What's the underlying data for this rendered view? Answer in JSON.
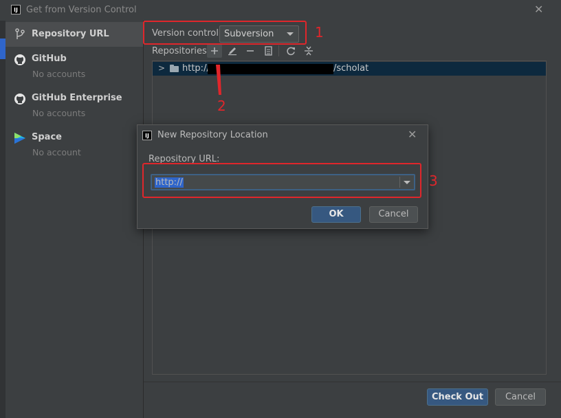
{
  "window": {
    "title": "Get from Version Control",
    "logo_text": "IJ"
  },
  "sidebar": {
    "items": [
      {
        "title": "Repository URL",
        "subtitle": "",
        "icon": "branch-icon",
        "selected": true
      },
      {
        "title": "GitHub",
        "subtitle": "No accounts",
        "icon": "github-icon",
        "selected": false
      },
      {
        "title": "GitHub Enterprise",
        "subtitle": "No accounts",
        "icon": "github-icon",
        "selected": false
      },
      {
        "title": "Space",
        "subtitle": "No account",
        "icon": "space-icon",
        "selected": false
      }
    ]
  },
  "main": {
    "version_control_label": "Version control:",
    "version_control_value": "Subversion",
    "repositories_label": "Repositories:",
    "toolbar": [
      "add-icon",
      "edit-icon",
      "remove-icon",
      "copy-icon",
      "refresh-icon",
      "collapse-icon"
    ],
    "repo_row": {
      "prefix": "http://",
      "suffix": "/scholat"
    }
  },
  "annotations": {
    "n1": "1",
    "n2": "2",
    "n3": "3"
  },
  "dialog": {
    "title": "New Repository Location",
    "url_label": "Repository URL:",
    "url_value": "http://",
    "ok_label": "OK",
    "cancel_label": "Cancel"
  },
  "footer": {
    "checkout_label": "Check Out",
    "cancel_label": "Cancel"
  },
  "colors": {
    "accent": "#365880",
    "annotation": "#e0262b",
    "selection": "#0d293e"
  }
}
